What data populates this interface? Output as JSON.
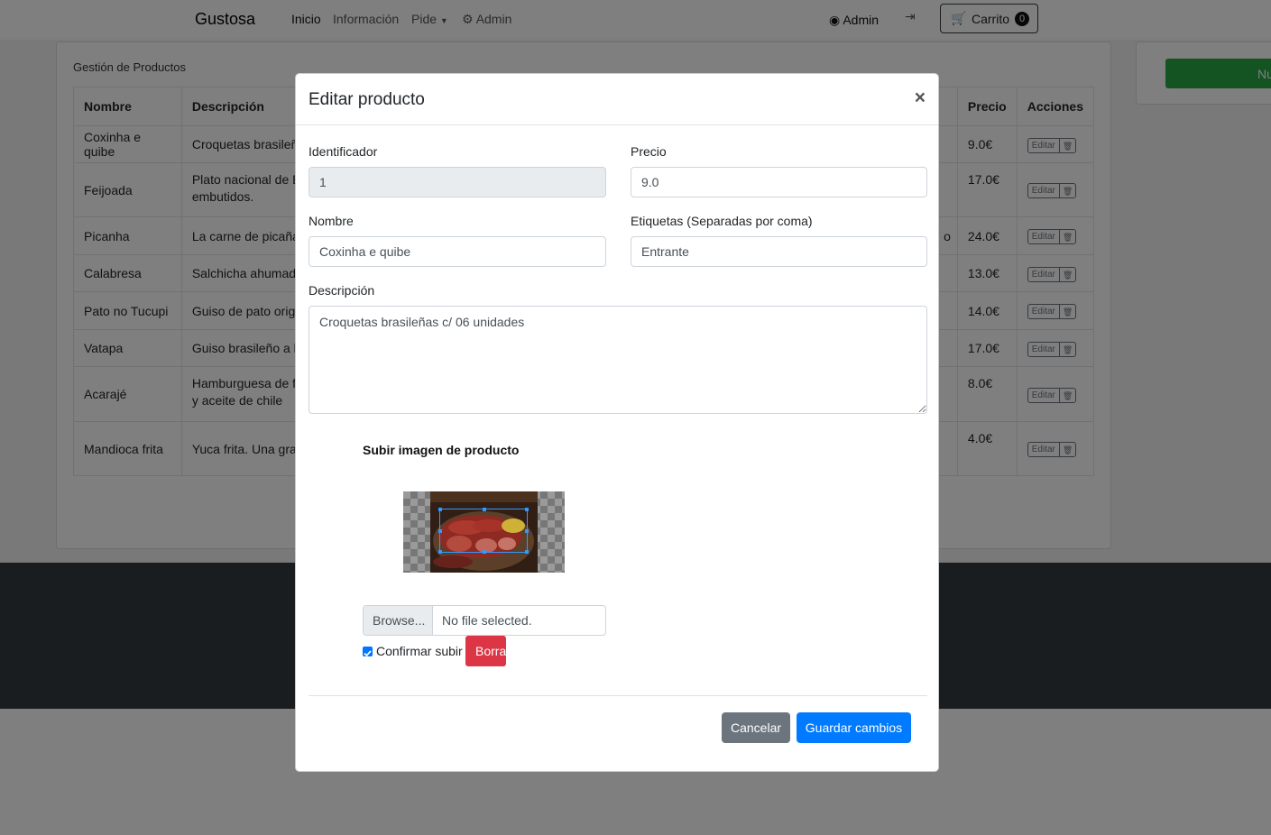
{
  "navbar": {
    "brand": "Gustosa",
    "links": [
      "Inicio",
      "Información",
      "Pide",
      "Admin"
    ],
    "user": "Admin",
    "cart_label": "Carrito",
    "cart_count": "0"
  },
  "card": {
    "title": "Gestión de Productos",
    "side_button": "Nu"
  },
  "table": {
    "headers": [
      "Nombre",
      "Descripción",
      "Precio",
      "Acciones"
    ],
    "rows": [
      {
        "name": "Coxinha e quibe",
        "desc1": "Croquetas brasileña",
        "desc2": "",
        "price": "9.0€"
      },
      {
        "name": "Feijoada",
        "desc1": "Plato nacional de B",
        "desc2": "embutidos.",
        "price": "17.0€"
      },
      {
        "name": "Picanha",
        "desc1": "La carne de picaña",
        "desc2": "",
        "price": "24.0€",
        "tail": "o"
      },
      {
        "name": "Calabresa",
        "desc1": "Salchicha ahumada",
        "desc2": "",
        "price": "13.0€"
      },
      {
        "name": "Pato no Tucupi",
        "desc1": "Guiso de pato orig",
        "desc2": "",
        "price": "14.0€"
      },
      {
        "name": "Vatapa",
        "desc1": "Guiso brasileño a b",
        "desc2": "",
        "price": "17.0€"
      },
      {
        "name": "Acarajé",
        "desc1": "Hamburguesa de f",
        "desc2": "y aceite de chile",
        "price": "8.0€"
      },
      {
        "name": "Mandioca frita",
        "desc1": "Yuca frita. Una gra",
        "desc2": "",
        "price": "4.0€"
      }
    ],
    "edit_label": "Editar"
  },
  "modal": {
    "title": "Editar producto",
    "close": "×",
    "id_label": "Identificador",
    "id_value": "1",
    "price_label": "Precio",
    "price_value": "9.0",
    "name_label": "Nombre",
    "name_value": "Coxinha e quibe",
    "tags_label": "Etiquetas (Separadas por coma)",
    "tags_value": "Entrante",
    "desc_label": "Descripción",
    "desc_value": "Croquetas brasileñas c/ 06 unidades",
    "upload_title": "Subir imagen de producto",
    "browse_label": "Browse...",
    "file_name": "No file selected.",
    "confirm_label": "Confirmar subir",
    "delete_label": "Borrar",
    "cancel_label": "Cancelar",
    "save_label": "Guardar cambios"
  },
  "colors": {
    "primary": "#007bff",
    "danger": "#dc3545",
    "success": "#28a745",
    "secondary": "#6c757d",
    "dark": "#343a40"
  }
}
